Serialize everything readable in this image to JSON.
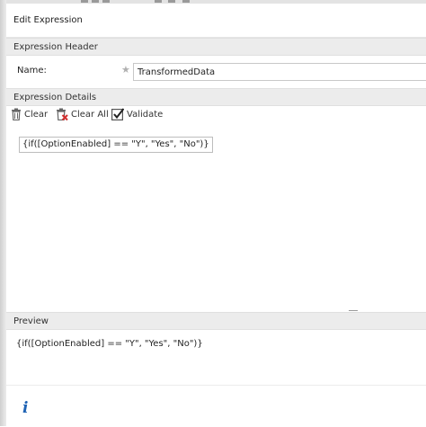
{
  "dialog": {
    "title": "Edit Expression"
  },
  "expression_header": {
    "title": "Expression Header",
    "name_label": "Name:",
    "name_value": "TransformedData",
    "required_icon": "star-icon"
  },
  "expression_details": {
    "title": "Expression Details",
    "toolbar": {
      "clear_label": "Clear",
      "clear_icon": "trash-icon",
      "clear_all_label": "Clear All",
      "clear_all_icon": "trash-x-icon",
      "validate_label": "Validate",
      "validate_icon": "checkbox-check-icon"
    },
    "expression": "{if([OptionEnabled] == \"Y\", \"Yes\", \"No\")}"
  },
  "preview": {
    "title": "Preview",
    "text": "{if([OptionEnabled] == \"Y\", \"Yes\", \"No\")}"
  },
  "footer": {
    "info_icon_glyph": "i"
  },
  "colors": {
    "section_header_bg": "#ececec",
    "info_blue": "#1f63b4",
    "delete_red": "#d32f2f"
  }
}
